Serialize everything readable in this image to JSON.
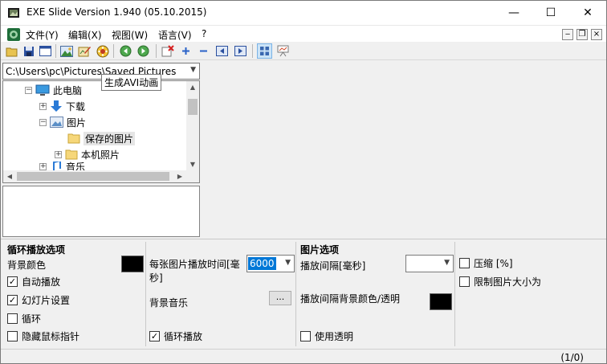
{
  "window": {
    "title": "EXE Slide Version 1.940 (05.10.2015)",
    "minimize_glyph": "—",
    "maximize_glyph": "☐",
    "close_glyph": "✕"
  },
  "menu": {
    "items": [
      "文件(Y)",
      "编辑(X)",
      "视图(W)",
      "语言(V)",
      "?"
    ],
    "mdi_minimize": "‒",
    "mdi_restore": "❐",
    "mdi_close": "×"
  },
  "toolbar": {
    "tooltip": "生成AVI动画"
  },
  "path": {
    "value": "C:\\Users\\pc\\Pictures\\Saved Pictures",
    "dropdown": "▼"
  },
  "tree": {
    "items": [
      {
        "expander": "−",
        "label": "此电脑",
        "icon": "computer-icon"
      },
      {
        "expander": "+",
        "label": "下载",
        "icon": "download-arrow-icon"
      },
      {
        "expander": "−",
        "label": "图片",
        "icon": "pictures-icon"
      },
      {
        "expander": "",
        "label": "保存的图片",
        "icon": "folder-icon"
      },
      {
        "expander": "+",
        "label": "本机照片",
        "icon": "folder-icon"
      },
      {
        "expander": "+",
        "label": "音乐",
        "icon": "music-icon"
      }
    ]
  },
  "loop_options": {
    "title": "循环播放选项",
    "bg_color_label": "背景颜色",
    "autoplay": "自动播放",
    "slide_settings": "幻灯片设置",
    "loop": "循环",
    "hide_cursor": "隐藏鼠标指针",
    "check": "✓"
  },
  "timing": {
    "per_image_label": "每张图片播放时间[毫秒]",
    "per_image_value": "6000",
    "bg_music_label": "背景音乐",
    "browse": "...",
    "loop_play": "循环播放"
  },
  "image_options": {
    "title": "图片选项",
    "interval_label": "播放间隔[毫秒]",
    "interval_bg_label": "播放间隔背景颜色/透明",
    "use_transparency": "使用透明"
  },
  "compress": {
    "compress_label": "压缩 [%]",
    "limit_size": "限制图片大小为"
  },
  "status": {
    "count": "(1/0)"
  },
  "colors": {
    "accent": "#0078d7",
    "swatch": "#000000"
  }
}
